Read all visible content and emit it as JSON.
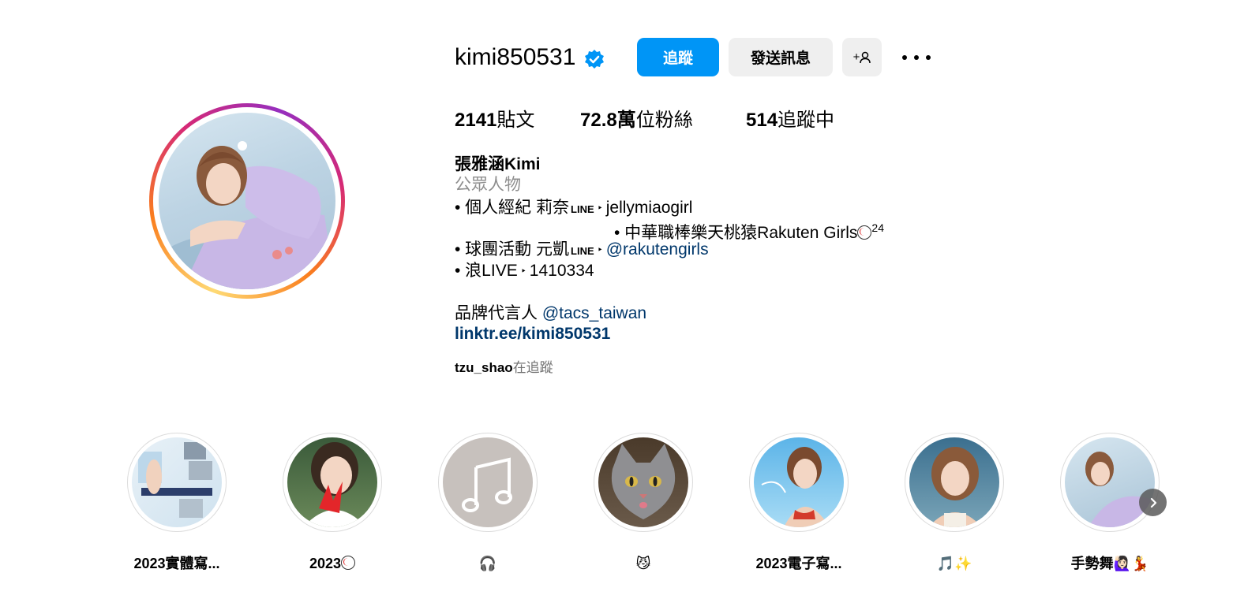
{
  "profile": {
    "username": "kimi850531",
    "follow_label": "追蹤",
    "message_label": "發送訊息",
    "add_user_label": "+",
    "stats": {
      "posts_count": "2141",
      "posts_label": "貼文",
      "followers_count": "72.8萬",
      "followers_label": "位粉絲",
      "following_count": "514",
      "following_label": "追蹤中"
    },
    "display_name": "張雅涵Kimi",
    "category": "公眾人物",
    "bio": {
      "line1_text": "• 個人經紀 莉奈",
      "line1_line": "LINE",
      "line1_arrow": "‣",
      "line1_id": "jellymiaogirl",
      "line2_text": "• 中華職棒樂天桃猿Rakuten Girls",
      "line2_super": "24",
      "line3_text": "• 球團活動 元凱",
      "line3_line": "LINE",
      "line3_arrow": "‣",
      "line3_link": "@rakutengirls",
      "line4_text": "• 浪LIVE",
      "line4_arrow": "‣",
      "line4_id": "1410334",
      "brand_text": "品牌代言人",
      "brand_link": "@tacs_taiwan"
    },
    "link": "linktr.ee/kimi850531",
    "followed_by_user": "tzu_shao",
    "followed_by_suffix": "在追蹤"
  },
  "highlights": [
    {
      "label": "2023實體寫...",
      "icon": "photo-collage"
    },
    {
      "label": "2023",
      "icon": "baseball-icon"
    },
    {
      "label": "🎧",
      "icon": "music-note-icon"
    },
    {
      "label": "😼",
      "icon": "cat-photo"
    },
    {
      "label": "2023電子寫...",
      "icon": "pool-photo"
    },
    {
      "label": "🎵✨",
      "icon": "portrait-photo"
    },
    {
      "label": "手勢舞🙋🏻‍♀️💃",
      "icon": "portrait-photo"
    }
  ],
  "colors": {
    "accent": "#0095f6",
    "link": "#00376b",
    "muted": "#8e8e8e",
    "button_bg": "#efefef"
  }
}
